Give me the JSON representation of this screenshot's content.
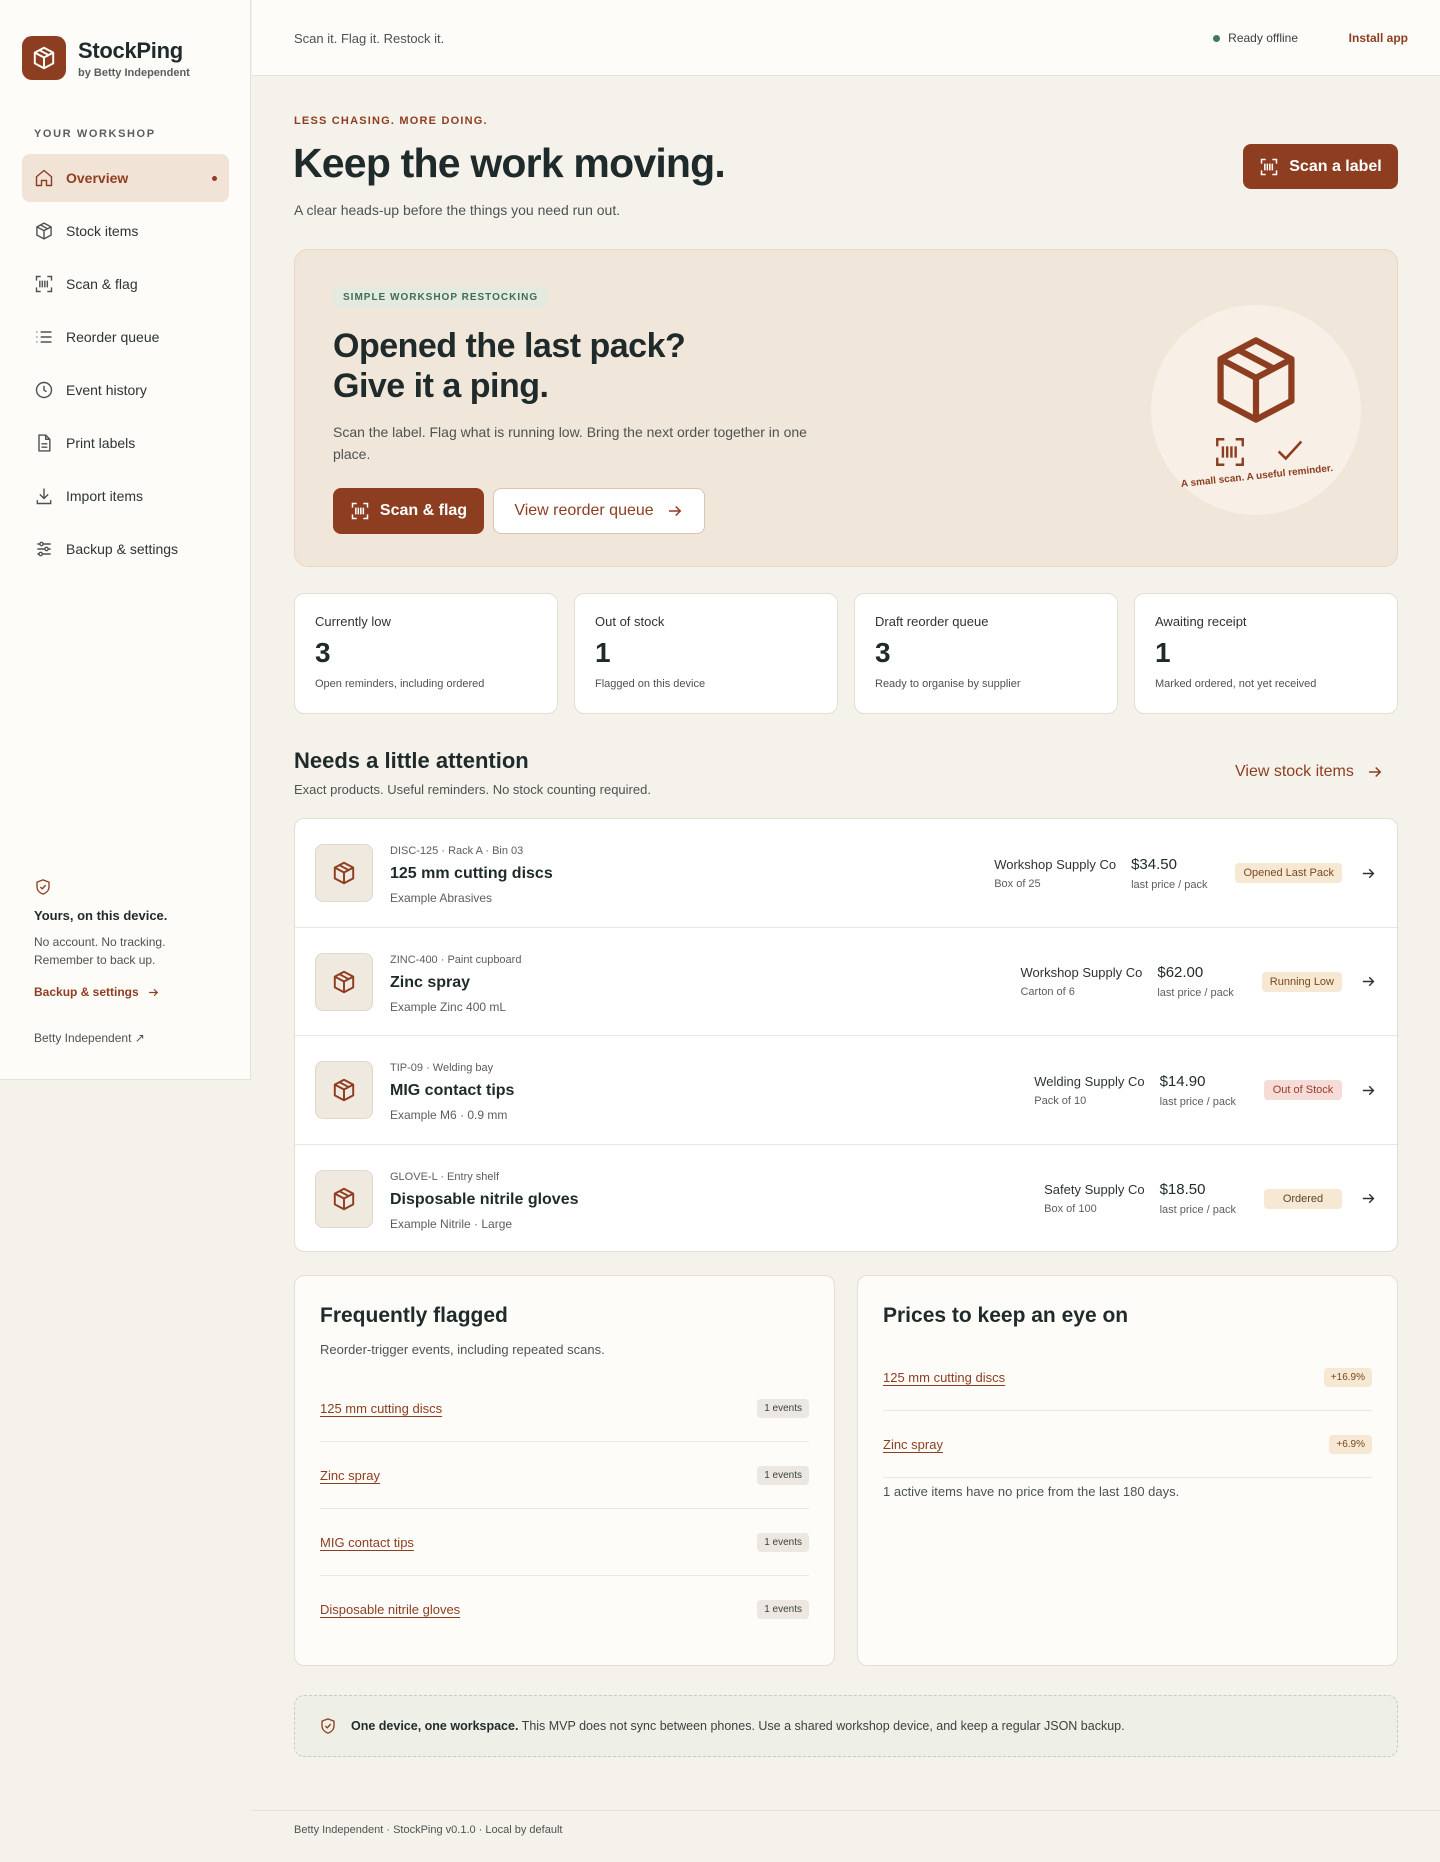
{
  "brand": {
    "name": "StockPing",
    "sub": "by Betty Independent"
  },
  "sidebar": {
    "section_label": "YOUR WORKSHOP",
    "items": [
      {
        "label": "Overview",
        "icon": "home-icon",
        "active": true
      },
      {
        "label": "Stock items",
        "icon": "box-icon"
      },
      {
        "label": "Scan & flag",
        "icon": "scan-icon"
      },
      {
        "label": "Reorder queue",
        "icon": "list-icon"
      },
      {
        "label": "Event history",
        "icon": "clock-icon"
      },
      {
        "label": "Print labels",
        "icon": "document-icon"
      },
      {
        "label": "Import items",
        "icon": "download-icon"
      },
      {
        "label": "Backup & settings",
        "icon": "sliders-icon"
      }
    ],
    "footer": {
      "title": "Yours, on this device.",
      "text": "No account. No tracking. Remember to back up.",
      "link": "Backup & settings",
      "brand": "Betty Independent ↗"
    }
  },
  "topbar": {
    "tagline": "Scan it. Flag it. Restock it.",
    "status": "Ready offline",
    "install": "Install app"
  },
  "header": {
    "eyebrow": "LESS CHASING. MORE DOING.",
    "title": "Keep the work moving.",
    "subtitle": "A clear heads-up before the things you need run out.",
    "scan_button": "Scan a label"
  },
  "hero": {
    "chip": "SIMPLE WORKSHOP RESTOCKING",
    "title_line1": "Opened the last pack?",
    "title_line2": "Give it a ping.",
    "text": "Scan the label. Flag what is running low. Bring the next order together in one place.",
    "primary": "Scan & flag",
    "secondary": "View reorder queue",
    "art_caption": "A small scan. A useful reminder."
  },
  "stats": [
    {
      "label": "Currently low",
      "value": "3",
      "note": "Open reminders, including ordered"
    },
    {
      "label": "Out of stock",
      "value": "1",
      "note": "Flagged on this device"
    },
    {
      "label": "Draft reorder queue",
      "value": "3",
      "note": "Ready to organise by supplier"
    },
    {
      "label": "Awaiting receipt",
      "value": "1",
      "note": "Marked ordered, not yet received"
    }
  ],
  "attention": {
    "title": "Needs a little attention",
    "subtitle": "Exact products. Useful reminders. No stock counting required.",
    "view_link": "View stock items",
    "rows": [
      {
        "code": "DISC-125 · Rack A · Bin 03",
        "name": "125 mm cutting discs",
        "desc": "Example Abrasives",
        "supplier": "Workshop Supply Co",
        "pack": "Box of 25",
        "price": "$34.50",
        "unit": "last price / pack",
        "status": "Opened Last Pack",
        "status_kind": "opened"
      },
      {
        "code": "ZINC-400 · Paint cupboard",
        "name": "Zinc spray",
        "desc": "Example Zinc 400 mL",
        "supplier": "Workshop Supply Co",
        "pack": "Carton of 6",
        "price": "$62.00",
        "unit": "last price / pack",
        "status": "Running Low",
        "status_kind": "low"
      },
      {
        "code": "TIP-09 · Welding bay",
        "name": "MIG contact tips",
        "desc": "Example M6 · 0.9 mm",
        "supplier": "Welding Supply Co",
        "pack": "Pack of 10",
        "price": "$14.90",
        "unit": "last price / pack",
        "status": "Out of Stock",
        "status_kind": "out"
      },
      {
        "code": "GLOVE-L · Entry shelf",
        "name": "Disposable nitrile gloves",
        "desc": "Example Nitrile · Large",
        "supplier": "Safety Supply Co",
        "pack": "Box of 100",
        "price": "$18.50",
        "unit": "last price / pack",
        "status": "Ordered",
        "status_kind": "ordered"
      }
    ]
  },
  "frequently_flagged": {
    "title": "Frequently flagged",
    "subtitle": "Reorder-trigger events, including repeated scans.",
    "items": [
      {
        "name": "125 mm cutting discs",
        "count": "1 events"
      },
      {
        "name": "Zinc spray",
        "count": "1 events"
      },
      {
        "name": "MIG contact tips",
        "count": "1 events"
      },
      {
        "name": "Disposable nitrile gloves",
        "count": "1 events"
      }
    ]
  },
  "prices": {
    "title": "Prices to keep an eye on",
    "items": [
      {
        "name": "125 mm cutting discs",
        "change": "+16.9%"
      },
      {
        "name": "Zinc spray",
        "change": "+6.9%"
      }
    ],
    "note": "1 active items have no price from the last 180 days."
  },
  "notice": {
    "bold": "One device, one workspace.",
    "text": " This MVP does not sync between phones. Use a shared workshop device, and keep a regular JSON backup."
  },
  "footer": "Betty Independent · StockPing v0.1.0 · Local by default",
  "colors": {
    "accent": "#8e3e20",
    "online": "#3f7a5e"
  }
}
